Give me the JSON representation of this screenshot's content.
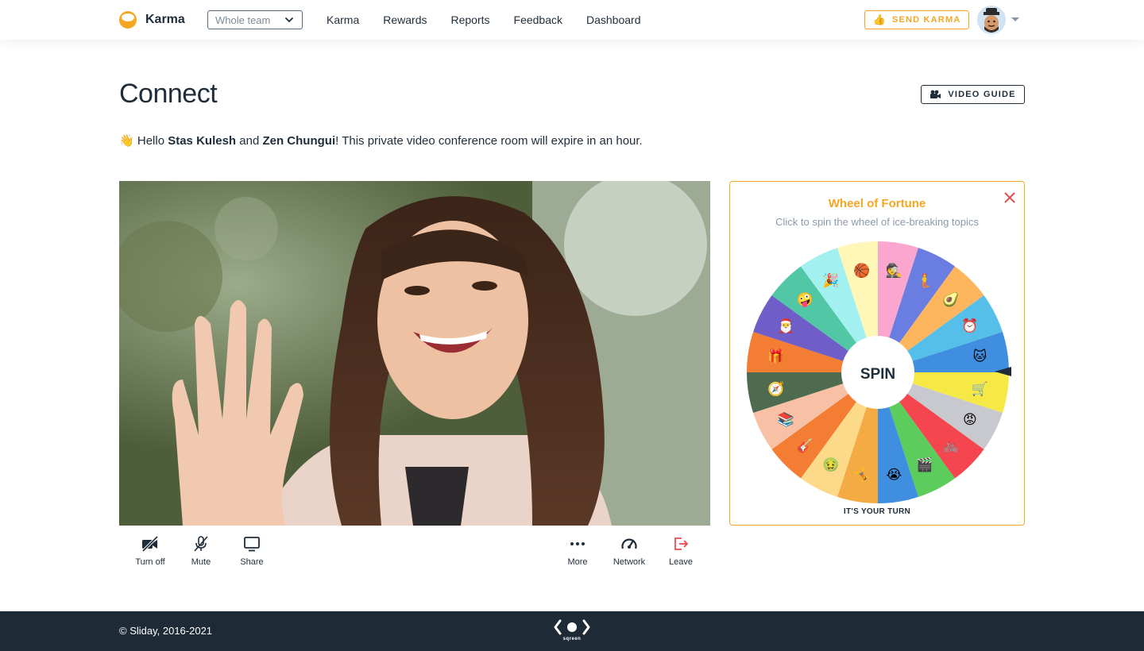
{
  "brand": {
    "name": "Karma"
  },
  "team_select": {
    "value": "Whole team"
  },
  "nav": [
    "Karma",
    "Rewards",
    "Reports",
    "Feedback",
    "Dashboard"
  ],
  "send_karma": {
    "label": "SEND KARMA",
    "icon": "thumbs-up-icon"
  },
  "page": {
    "title": "Connect",
    "video_guide_label": "VIDEO GUIDE",
    "greeting": {
      "wave": "👋",
      "hello": "Hello",
      "user_a": "Stas Kulesh",
      "and": "and",
      "user_b": "Zen Chungui",
      "suffix": "! This private video conference room will expire in an hour."
    }
  },
  "controls": {
    "left": [
      {
        "label": "Turn off",
        "icon": "camera-off-icon"
      },
      {
        "label": "Mute",
        "icon": "mic-off-icon"
      },
      {
        "label": "Share",
        "icon": "monitor-icon"
      }
    ],
    "right": [
      {
        "label": "More",
        "icon": "more-dots-icon"
      },
      {
        "label": "Network",
        "icon": "speedometer-icon"
      },
      {
        "label": "Leave",
        "icon": "leave-icon"
      }
    ]
  },
  "wheel": {
    "title": "Wheel of Fortune",
    "subtitle": "Click to spin the wheel of ice-breaking topics",
    "spin_label": "SPIN",
    "turn_label": "IT'S YOUR TURN",
    "segments": [
      {
        "color": "#fba6cf",
        "emoji": "🕵"
      },
      {
        "color": "#6a7de0",
        "emoji": "🧜"
      },
      {
        "color": "#fdb55e",
        "emoji": "🥑"
      },
      {
        "color": "#55bfea",
        "emoji": "⏰"
      },
      {
        "color": "#3f8ee0",
        "emoji": "🐱"
      },
      {
        "color": "#f7e945",
        "emoji": "🛒"
      },
      {
        "color": "#c8c8cf",
        "emoji": "😡"
      },
      {
        "color": "#f5454f",
        "emoji": "🚲"
      },
      {
        "color": "#5ccc5c",
        "emoji": "🎬"
      },
      {
        "color": "#3f8ee0",
        "emoji": "😭"
      },
      {
        "color": "#f5ab43",
        "emoji": "🤸"
      },
      {
        "color": "#fdd98a",
        "emoji": "🤢"
      },
      {
        "color": "#f27d33",
        "emoji": "🎸"
      },
      {
        "color": "#f8c0a4",
        "emoji": "📚"
      },
      {
        "color": "#4f6b4f",
        "emoji": "🧭"
      },
      {
        "color": "#f27d33",
        "emoji": "🎁"
      },
      {
        "color": "#6f5dc8",
        "emoji": "🎅"
      },
      {
        "color": "#51c7a6",
        "emoji": "🤪"
      },
      {
        "color": "#a3f0f0",
        "emoji": "🎉"
      },
      {
        "color": "#fff7b8",
        "emoji": "🏀"
      }
    ]
  },
  "footer": {
    "copyright": "© Sliday, 2016-2021",
    "logo_label": "sqreen"
  }
}
